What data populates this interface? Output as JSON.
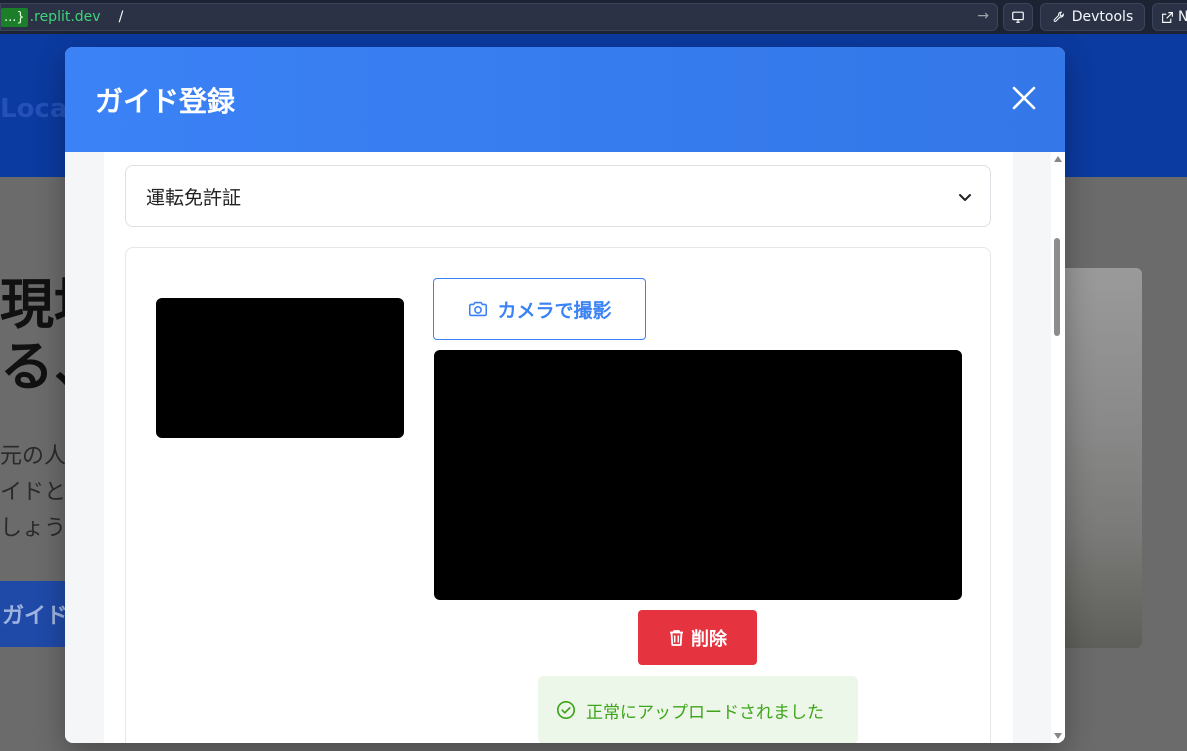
{
  "browser": {
    "url_host_tag": "...}",
    "url_host": ".replit.dev",
    "url_path": "/",
    "devtools_label": "Devtools",
    "newtab_label": "N"
  },
  "background": {
    "logo_text": "Loca",
    "hero_title_lines": [
      "現地",
      "る、"
    ],
    "hero_text_lines": [
      "元の人",
      "イドと",
      "しょう"
    ],
    "cta_label": "ガイド"
  },
  "modal": {
    "title": "ガイド登録",
    "document_select": {
      "selected": "運転免許証"
    },
    "camera_button_label": "カメラで撮影",
    "delete_button_label": "削除",
    "success_message": "正常にアップロードされました"
  },
  "colors": {
    "primary": "#3b82f6",
    "danger": "#e5343f",
    "success": "#3ea51a",
    "success_bg": "#edf7e9"
  }
}
